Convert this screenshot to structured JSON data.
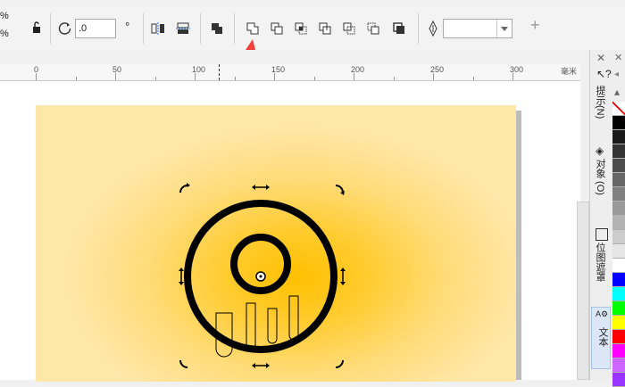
{
  "toolbar": {
    "scale_top": "%",
    "scale_bottom": "%",
    "rotation_value": ".0",
    "degree_symbol": "°",
    "outline_width_value": "",
    "add_label": "+"
  },
  "ruler": {
    "labels": [
      "0",
      "50",
      "100",
      "150",
      "200",
      "250",
      "300"
    ],
    "unit_label": "毫米"
  },
  "dockers": {
    "hints": "提示(N)",
    "objects": "对象 (O)",
    "position_modes": "位图遮罩",
    "text": "文本"
  },
  "colors": {
    "accent_arrow": "#f0403c",
    "page_center": "#ffc000",
    "page_edge": "#ffe7aa",
    "palette": [
      "#ffffff",
      "#000000",
      "#1a1a1a",
      "#333333",
      "#4d4d4d",
      "#666666",
      "#808080",
      "#999999",
      "#b3b3b3",
      "#cccccc",
      "#e6e6e6",
      "#ffffff",
      "#0000ff",
      "#00ffff",
      "#00ff00",
      "#ffff00",
      "#ff0000",
      "#ff00ff",
      "#cc66ff",
      "#9933ff"
    ]
  }
}
